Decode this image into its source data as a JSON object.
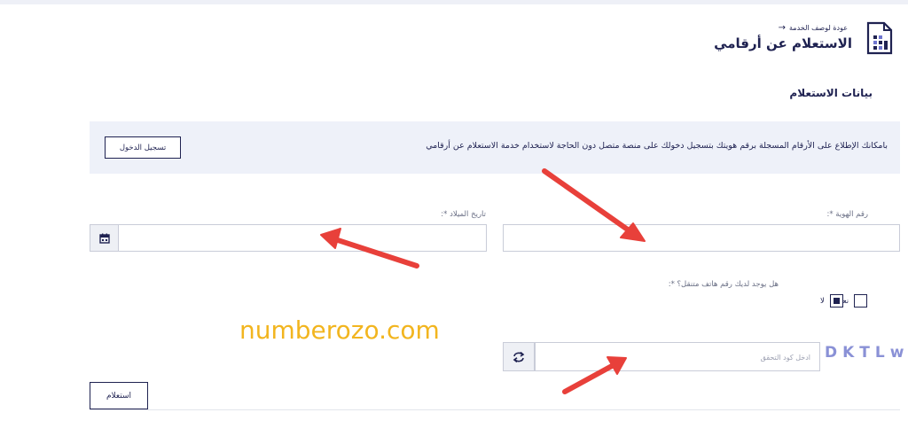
{
  "header": {
    "back_link": "عودة لوصف الخدمة",
    "title": "الاستعلام عن أرقامي"
  },
  "section": {
    "title": "بيانات الاستعلام"
  },
  "banner": {
    "text": "بامكانك الإطلاع على الأرقام المسجلة برقم هويتك بتسجيل دخولك على منصة متصل دون الحاجة لاستخدام خدمة الاستعلام عن أرقامي",
    "login_label": "تسجيل الدخول"
  },
  "form": {
    "id_label": "رقم الهوية *:",
    "id_value": "",
    "dob_label": "تاريخ الميلاد *:",
    "dob_value": "",
    "mobile_question": "هل يوجد لديك رقم هاتف متنقل؟ *:",
    "yes_label": "نعم",
    "no_label": "لا",
    "selected_option": "لا",
    "captcha_placeholder": "ادخل كود التحقق",
    "captcha_code": "DKTLw",
    "submit_label": "استعلام"
  },
  "watermark": "numberozo.com",
  "colors": {
    "primary": "#1f2251",
    "banner_bg": "#eef1f9",
    "annotation_arrow": "#e8403a",
    "watermark": "#f2b51f",
    "captcha_text": "#8a91d6"
  }
}
